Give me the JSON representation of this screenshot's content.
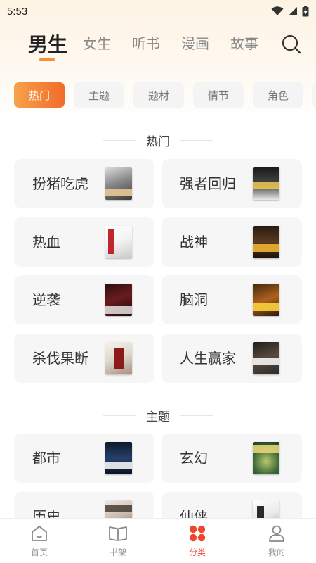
{
  "status_bar": {
    "time": "5:53"
  },
  "nav": {
    "tabs": [
      {
        "label": "男生",
        "active": true
      },
      {
        "label": "女生",
        "active": false
      },
      {
        "label": "听书",
        "active": false
      },
      {
        "label": "漫画",
        "active": false
      },
      {
        "label": "故事",
        "active": false
      }
    ],
    "search_icon": "search-icon",
    "accent_color": "#f39233"
  },
  "chips": [
    {
      "label": "热门",
      "active": true
    },
    {
      "label": "主题",
      "active": false
    },
    {
      "label": "题材",
      "active": false
    },
    {
      "label": "情节",
      "active": false
    },
    {
      "label": "角色",
      "active": false
    }
  ],
  "sections": [
    {
      "title": "热门",
      "items": [
        {
          "label": "扮猪吃虎"
        },
        {
          "label": "强者回归"
        },
        {
          "label": "热血"
        },
        {
          "label": "战神"
        },
        {
          "label": "逆袭"
        },
        {
          "label": "脑洞"
        },
        {
          "label": "杀伐果断"
        },
        {
          "label": "人生赢家"
        }
      ]
    },
    {
      "title": "主题",
      "items": [
        {
          "label": "都市"
        },
        {
          "label": "玄幻"
        },
        {
          "label": "历史"
        },
        {
          "label": "仙侠"
        }
      ]
    }
  ],
  "bottom_nav": [
    {
      "label": "首页",
      "icon": "home-icon",
      "active": false
    },
    {
      "label": "书架",
      "icon": "bookshelf-icon",
      "active": false
    },
    {
      "label": "分类",
      "icon": "category-icon",
      "active": true
    },
    {
      "label": "我的",
      "icon": "profile-icon",
      "active": false
    }
  ],
  "colors": {
    "active_red": "#f0462f",
    "chip_gradient_start": "#f6a24a",
    "chip_gradient_end": "#f26b2a"
  }
}
